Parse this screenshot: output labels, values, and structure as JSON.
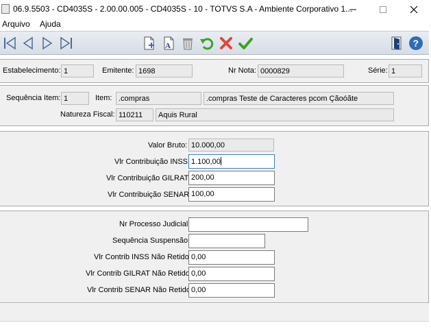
{
  "window": {
    "title": "06.9.5503 - CD4035S - 2.00.00.005 - CD4035S - 10 - TOTVS S.A - Ambiente Corporativo 1...",
    "minimize_icon": "minimize-icon",
    "maximize_icon": "maximize-icon",
    "close_icon": "close-icon"
  },
  "menu": {
    "items": [
      "Arquivo",
      "Ajuda"
    ]
  },
  "toolbar": {
    "nav_icons": [
      "first-record-icon",
      "previous-record-icon",
      "next-record-icon",
      "last-record-icon"
    ],
    "action_icons": [
      "new-record-icon",
      "edit-record-icon",
      "delete-record-icon",
      "undo-icon",
      "cancel-icon",
      "confirm-icon"
    ],
    "right_icons": [
      "exit-icon",
      "help-icon"
    ]
  },
  "header": {
    "estabelecimento_label": "Estabelecimento:",
    "estabelecimento_value": "1",
    "emitente_label": "Emitente:",
    "emitente_value": "1698",
    "nr_nota_label": "Nr Nota:",
    "nr_nota_value": "0000829",
    "serie_label": "Série:",
    "serie_value": "1"
  },
  "item": {
    "sequencia_label": "Sequência Item:",
    "sequencia_value": "1",
    "item_label": "Item:",
    "item_code": ".compras",
    "item_description": ".compras Teste de Caracteres pcom Çãoóãte",
    "natureza_label": "Natureza Fiscal:",
    "natureza_code": "110211",
    "natureza_description": "Aquis Rural"
  },
  "valores": {
    "valor_bruto_label": "Valor Bruto:",
    "valor_bruto_value": "10.000,00",
    "inss_label": "Vlr Contribuição INSS:",
    "inss_value": "1.100,00",
    "gilrat_label": "Vlr Contribuição GILRAT:",
    "gilrat_value": "200,00",
    "senar_label": "Vlr Contribuição SENAR:",
    "senar_value": "100,00"
  },
  "processo": {
    "nr_processo_label": "Nr Processo Judicial:",
    "nr_processo_value": "",
    "sequencia_suspensao_label": "Sequência Suspensão:",
    "sequencia_suspensao_value": "",
    "inss_nao_retido_label": "Vlr Contrib INSS Não Retido:",
    "inss_nao_retido_value": "0,00",
    "gilrat_nao_retido_label": "Vlr Contrib GILRAT Não Retido:",
    "gilrat_nao_retido_value": "0,00",
    "senar_nao_retido_label": "Vlr Contrib SENAR Não Retido:",
    "senar_nao_retido_value": "0,00"
  }
}
